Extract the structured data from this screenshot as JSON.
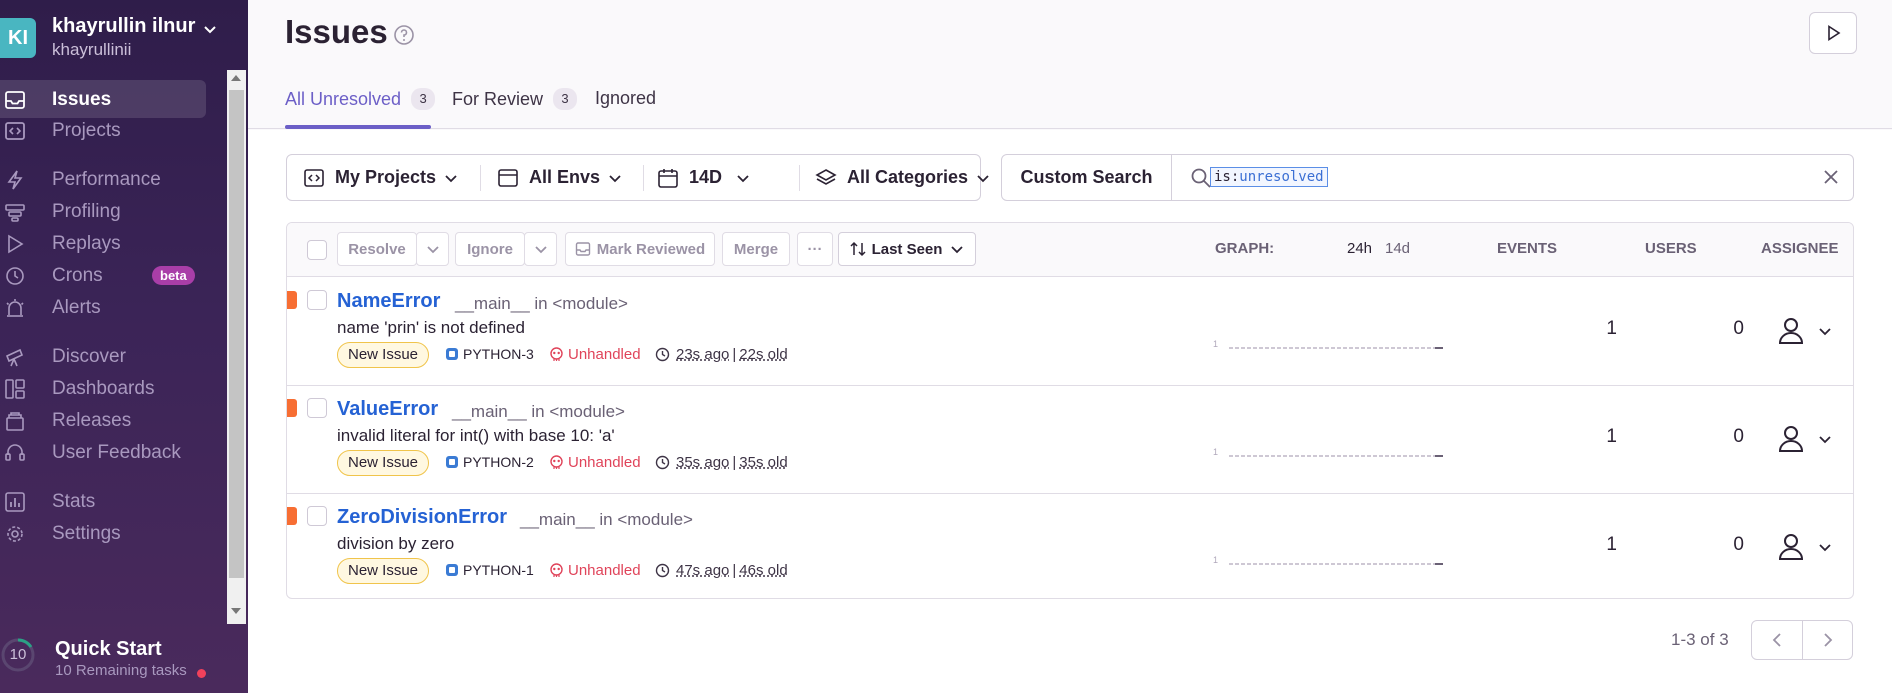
{
  "org": {
    "avatar": "KI",
    "name": "khayrullin ilnur",
    "user": "khayrullinii"
  },
  "sidebar": {
    "items": [
      {
        "label": "Issues",
        "active": true
      },
      {
        "label": "Projects"
      },
      {
        "label": "Performance"
      },
      {
        "label": "Profiling"
      },
      {
        "label": "Replays"
      },
      {
        "label": "Crons",
        "badge": "beta"
      },
      {
        "label": "Alerts"
      },
      {
        "label": "Discover"
      },
      {
        "label": "Dashboards"
      },
      {
        "label": "Releases"
      },
      {
        "label": "User Feedback"
      },
      {
        "label": "Stats"
      },
      {
        "label": "Settings"
      }
    ],
    "quick_start": {
      "count": "10",
      "title": "Quick Start",
      "subtitle": "10 Remaining tasks"
    }
  },
  "header": {
    "title": "Issues",
    "tabs": [
      {
        "label": "All Unresolved",
        "count": "3"
      },
      {
        "label": "For Review",
        "count": "3"
      },
      {
        "label": "Ignored"
      }
    ]
  },
  "filters": {
    "projects": "My Projects",
    "envs": "All Envs",
    "period": "14D",
    "categories": "All Categories",
    "custom_search": "Custom Search",
    "query_key": "is:",
    "query_value": "unresolved"
  },
  "table": {
    "actions": {
      "resolve": "Resolve",
      "ignore": "Ignore",
      "mark_reviewed": "Mark Reviewed",
      "merge": "Merge",
      "more": "···",
      "sort": "Last Seen"
    },
    "columns": {
      "graph": "GRAPH:",
      "graph_24h": "24h",
      "graph_14d": "14d",
      "events": "EVENTS",
      "users": "USERS",
      "assignee": "ASSIGNEE"
    },
    "rows": [
      {
        "title": "NameError",
        "location": "__main__ in <module>",
        "message": "name 'prin' is not defined",
        "badge": "New Issue",
        "project": "PYTHON-3",
        "handled": "Unhandled",
        "last_seen": "23s ago",
        "age": "22s old",
        "spark_label": "1",
        "events": "1",
        "users": "0"
      },
      {
        "title": "ValueError",
        "location": "__main__ in <module>",
        "message": "invalid literal for int() with base 10: 'a'",
        "badge": "New Issue",
        "project": "PYTHON-2",
        "handled": "Unhandled",
        "last_seen": "35s ago",
        "age": "35s old",
        "spark_label": "1",
        "events": "1",
        "users": "0"
      },
      {
        "title": "ZeroDivisionError",
        "location": "__main__ in <module>",
        "message": "division by zero",
        "badge": "New Issue",
        "project": "PYTHON-1",
        "handled": "Unhandled",
        "last_seen": "47s ago",
        "age": "46s old",
        "spark_label": "1",
        "events": "1",
        "users": "0"
      }
    ]
  },
  "pagination": {
    "info": "1-3 of 3"
  },
  "colors": {
    "accent": "#6c5fc7",
    "link": "#2562d4",
    "error_level": "#f76e33",
    "unhandled": "#e0445a"
  }
}
